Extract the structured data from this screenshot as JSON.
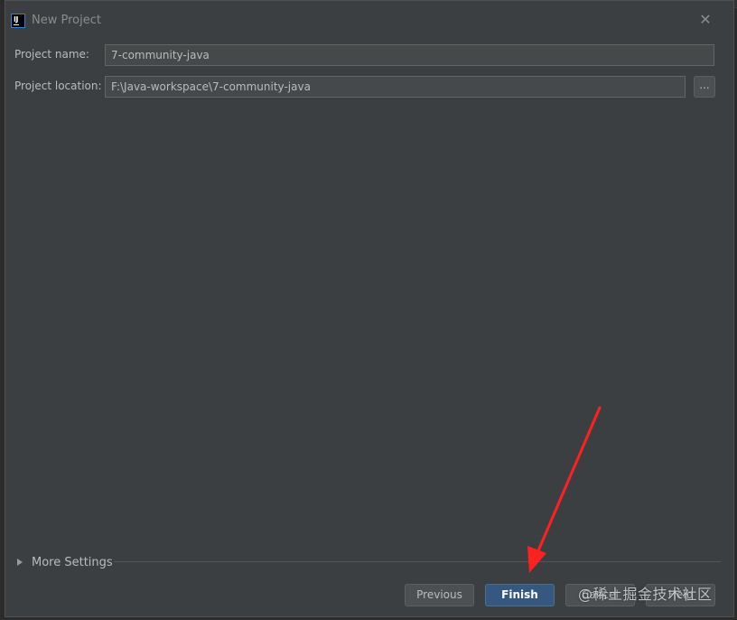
{
  "window": {
    "title": "New Project",
    "close_icon": "close-icon"
  },
  "form": {
    "project_name_label": "Project name:",
    "project_name_value": "7-community-java",
    "project_location_label": "Project location:",
    "project_location_value": "F:\\Java-workspace\\7-community-java",
    "browse_label": "..."
  },
  "more_settings": {
    "label": "More Settings",
    "expanded": false
  },
  "buttons": {
    "previous": "Previous",
    "finish": "Finish",
    "cancel": "Cancel",
    "help": "Help"
  },
  "annotation": {
    "arrow_color": "#ff2020",
    "watermark": "@稀土掘金技术社区"
  },
  "colors": {
    "dialog_bg": "#3c3f41",
    "field_bg": "#45494a",
    "primary_button": "#365880",
    "text": "#bbbbbb"
  }
}
